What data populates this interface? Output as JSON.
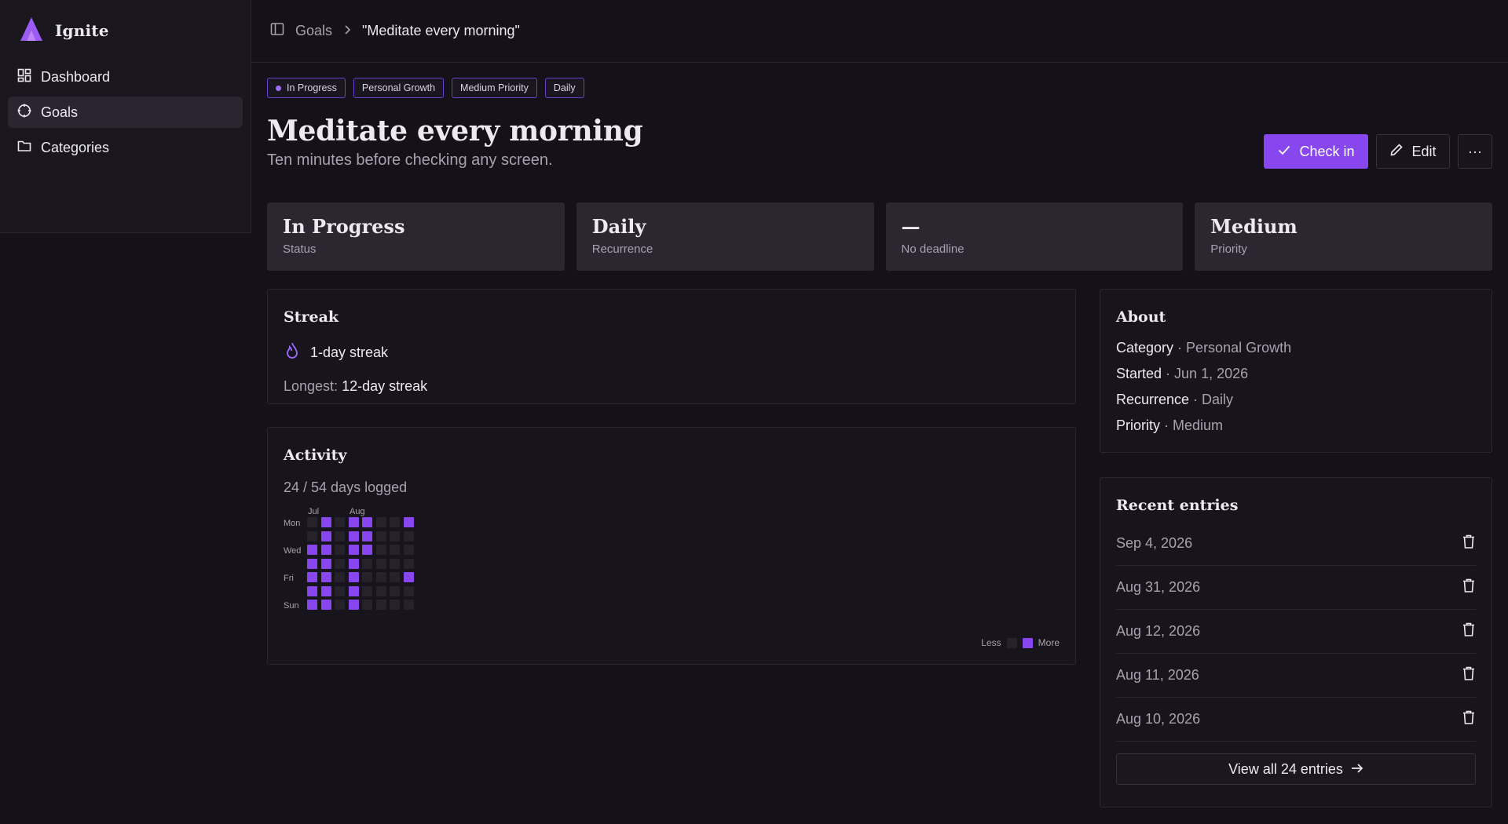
{
  "app": {
    "name": "Ignite",
    "accent": "#8847ee"
  },
  "sidebar": {
    "items": [
      {
        "label": "Dashboard",
        "icon": "dashboard-icon",
        "active": false
      },
      {
        "label": "Goals",
        "icon": "target-icon",
        "active": true
      },
      {
        "label": "Categories",
        "icon": "folder-icon",
        "active": false
      }
    ]
  },
  "breadcrumb": {
    "parent": "Goals",
    "current": "\"Meditate every morning\""
  },
  "goal": {
    "tags": [
      "In Progress",
      "Personal Growth",
      "Medium Priority",
      "Daily"
    ],
    "title": "Meditate every morning",
    "subtitle": "Ten minutes before checking any screen."
  },
  "actions": {
    "check_in": "Check in",
    "edit": "Edit",
    "more": "···"
  },
  "stats": [
    {
      "value": "In Progress",
      "label": "Status"
    },
    {
      "value": "Daily",
      "label": "Recurrence"
    },
    {
      "value": "—",
      "label": "No deadline"
    },
    {
      "value": "Medium",
      "label": "Priority"
    }
  ],
  "streak": {
    "heading": "Streak",
    "current": "1-day streak",
    "longest_label": "Longest:",
    "longest_value": "12-day streak"
  },
  "activity": {
    "heading": "Activity",
    "summary": "24 / 54 days logged",
    "months": [
      "Jul",
      "Aug"
    ],
    "day_labels": [
      "Mon",
      "Wed",
      "Fri",
      "Sun"
    ],
    "legend_less": "Less",
    "legend_more": "More",
    "weeks": [
      [
        0,
        0,
        1,
        1,
        1,
        1,
        1
      ],
      [
        1,
        1,
        1,
        1,
        1,
        1,
        1
      ],
      [
        0,
        0,
        0,
        0,
        0,
        0,
        0
      ],
      [
        1,
        1,
        1,
        1,
        1,
        1,
        1
      ],
      [
        1,
        1,
        1,
        0,
        0,
        0,
        0
      ],
      [
        0,
        0,
        0,
        0,
        0,
        0,
        0
      ],
      [
        0,
        0,
        0,
        0,
        0,
        0,
        0
      ],
      [
        1,
        0,
        0,
        0,
        1,
        0,
        0
      ]
    ]
  },
  "about": {
    "heading": "About",
    "rows": [
      {
        "key": "Category",
        "value": "Personal Growth"
      },
      {
        "key": "Started",
        "value": "Jun 1, 2026"
      },
      {
        "key": "Recurrence",
        "value": "Daily"
      },
      {
        "key": "Priority",
        "value": "Medium"
      }
    ]
  },
  "entries": {
    "heading": "Recent entries",
    "items": [
      "Sep 4, 2026",
      "Aug 31, 2026",
      "Aug 12, 2026",
      "Aug 11, 2026",
      "Aug 10, 2026"
    ],
    "view_all": "View all 24 entries"
  }
}
